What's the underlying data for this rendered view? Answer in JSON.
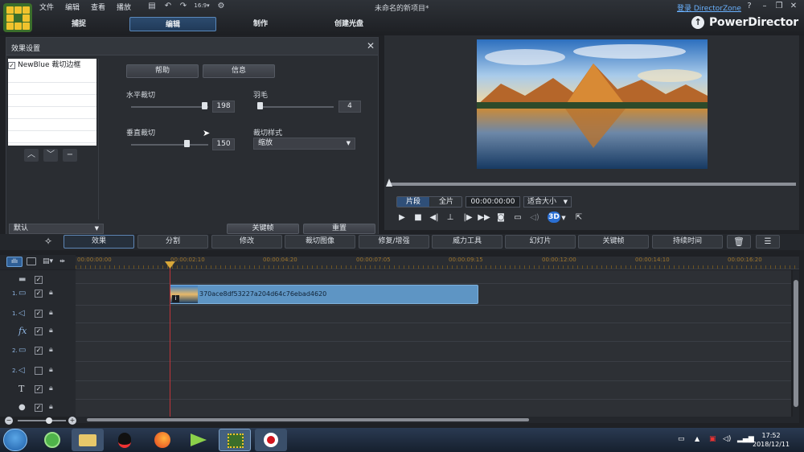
{
  "menu": [
    "文件",
    "编辑",
    "查看",
    "播放"
  ],
  "project_title": "未命名的新项目*",
  "login_link": "登录 DirectorZone",
  "window_buttons": [
    "?",
    "–",
    "❐",
    "✕"
  ],
  "mode_tabs": [
    "捕捉",
    "编辑",
    "制作",
    "创建光盘"
  ],
  "brand": "PowerDirector",
  "effect_panel": {
    "title": "效果设置",
    "effect_item": "NewBlue 裁切边框",
    "help_button": "帮助",
    "info_button": "信息",
    "h_crop_label": "水平裁切",
    "h_crop_value": "198",
    "v_crop_label": "垂直裁切",
    "v_crop_value": "150",
    "feather_label": "羽毛",
    "feather_value": "4",
    "crop_style_label": "裁切样式",
    "crop_style_value": "缩放",
    "preset_value": "默认",
    "keyframe_button": "关键帧",
    "reset_button": "重置"
  },
  "preview": {
    "seg_clip": "片段",
    "seg_full": "全片",
    "timecode": "00:00:00:00",
    "fit_dropdown": "适合大小",
    "badge_3d": "3D"
  },
  "toolbar": [
    "效果",
    "分割",
    "修改",
    "裁切图像",
    "修复/增强",
    "威力工具",
    "幻灯片",
    "关键帧",
    "持续时间"
  ],
  "ruler_ticks": [
    "00:00:00:00",
    "00:00:02:10",
    "00:00:04:20",
    "00:00:07:05",
    "00:00:09:15",
    "00:00:12:00",
    "00:00:14:10",
    "00:00:16:20"
  ],
  "tracks": [
    {
      "num": "",
      "icon": "video-all-icon",
      "checked": true
    },
    {
      "num": "1.",
      "icon": "video-track-icon",
      "checked": true
    },
    {
      "num": "1.",
      "icon": "audio-track-icon",
      "checked": true
    },
    {
      "num": "",
      "icon": "fx-track-icon",
      "checked": true
    },
    {
      "num": "2.",
      "icon": "video-track-icon",
      "checked": true
    },
    {
      "num": "2.",
      "icon": "audio-track-icon",
      "checked": false
    },
    {
      "num": "",
      "icon": "title-track-icon",
      "checked": true
    },
    {
      "num": "",
      "icon": "voice-track-icon",
      "checked": true
    }
  ],
  "clip_name": "370ace8df53227a204d64c76ebad4620",
  "clock": {
    "time": "17:52",
    "date": "2018/12/11"
  },
  "colors": {
    "accent": "#5e86b5",
    "clip": "#5e95c4",
    "playhead": "#c0343a",
    "ruler_text": "#a0762c"
  }
}
